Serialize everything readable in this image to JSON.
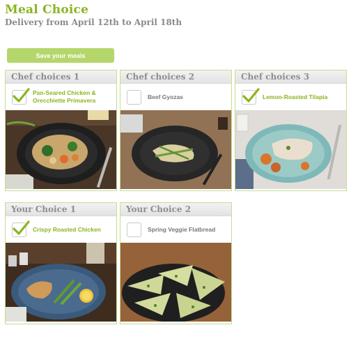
{
  "header": {
    "title": "Meal Choice",
    "subtitle": "Delivery from April 12th to April 18th"
  },
  "toolbar": {
    "save_label": "Save your meals"
  },
  "colors": {
    "accent": "#8bb41f",
    "button": "#b5d66b",
    "card_border": "#c5dc93",
    "header_text": "#8e8e8e"
  },
  "cards": [
    {
      "heading": "Chef choices 1",
      "meal": "Pan-Seared Chicken & Orecchiette Primavera",
      "checked": true,
      "icon": "checkmark-icon"
    },
    {
      "heading": "Chef choices 2",
      "meal": "Beef Gyozas",
      "checked": false,
      "icon": "checkmark-icon"
    },
    {
      "heading": "Chef choices 3",
      "meal": "Lemon-Roasted Tilapia",
      "checked": true,
      "icon": "checkmark-icon"
    },
    {
      "heading": "Your Choice 1",
      "meal": "Crispy Roasted Chicken",
      "checked": true,
      "icon": "checkmark-icon"
    },
    {
      "heading": "Your Choice 2",
      "meal": "Spring Veggie Flatbread",
      "checked": false,
      "icon": "checkmark-icon"
    }
  ]
}
